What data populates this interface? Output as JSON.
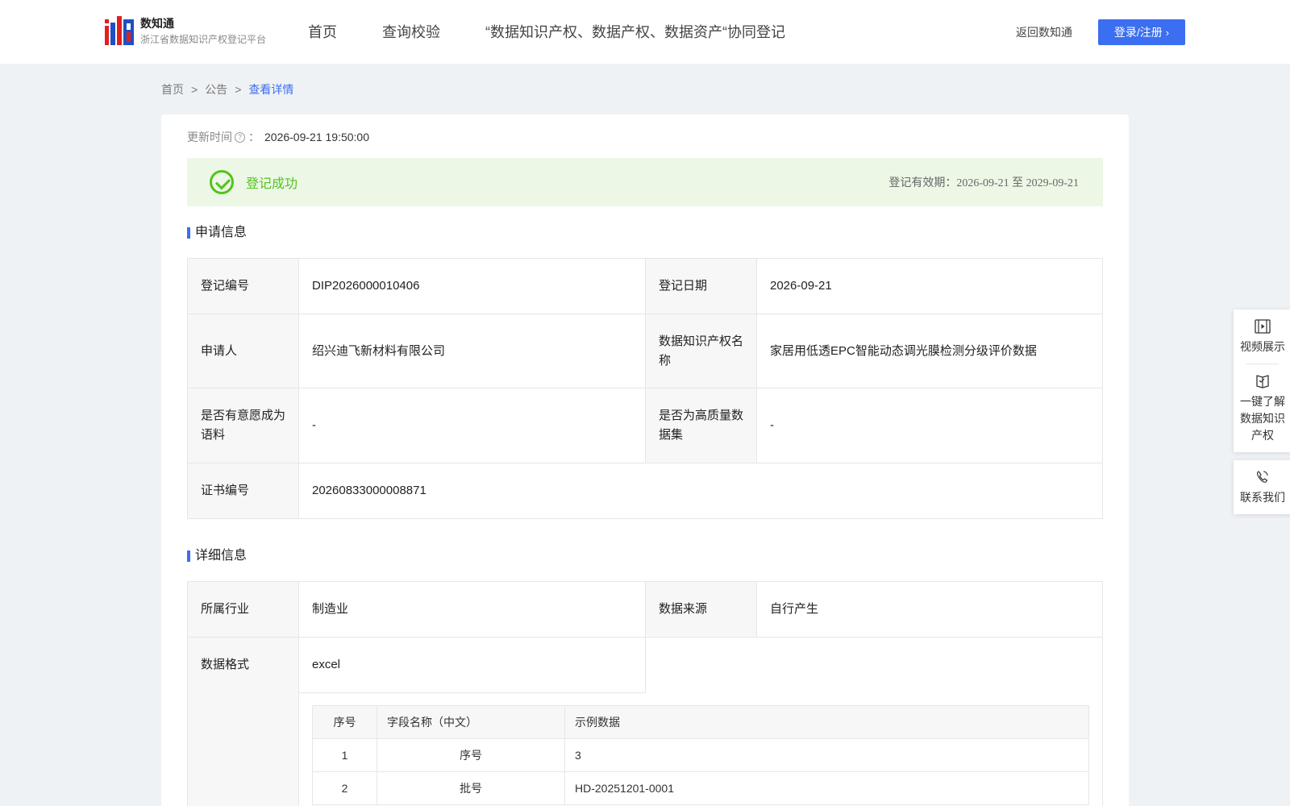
{
  "header": {
    "logo_name": "数知通",
    "logo_sub": "浙江省数据知识产权登记平台",
    "nav": [
      "首页",
      "查询校验",
      "“数据知识产权、数据产权、数据资产“协同登记"
    ],
    "back_link": "返回数知通",
    "login_label": "登录/注册"
  },
  "breadcrumb": {
    "items": [
      "首页",
      "公告",
      "查看详情"
    ],
    "sep": ">"
  },
  "update": {
    "label": "更新时间",
    "colon": "：",
    "value": "2026-09-21 19:50:00"
  },
  "status": {
    "text": "登记成功",
    "validity": "登记有效期：2026-09-21 至 2029-09-21",
    "color": "#52c41a"
  },
  "sections": {
    "apply_title": "申请信息",
    "detail_title": "详细信息"
  },
  "apply_info": {
    "reg_no_label": "登记编号",
    "reg_no": "DIP2026000010406",
    "reg_date_label": "登记日期",
    "reg_date": "2026-09-21",
    "applicant_label": "申请人",
    "applicant": "绍兴迪飞新材料有限公司",
    "ip_name_label": "数据知识产权名称",
    "ip_name": "家居用低透EPC智能动态调光膜检测分级评价数据",
    "corpus_label": "是否有意愿成为语料",
    "corpus": "-",
    "hq_label": "是否为高质量数据集",
    "hq": "-",
    "cert_label": "证书编号",
    "cert": "20260833000008871"
  },
  "detail_info": {
    "industry_label": "所属行业",
    "industry": "制造业",
    "source_label": "数据来源",
    "source": "自行产生",
    "format_label": "数据格式",
    "format": "excel"
  },
  "fields_table": {
    "headers": [
      "序号",
      "字段名称（中文）",
      "示例数据"
    ],
    "rows": [
      [
        "1",
        "序号",
        "3"
      ],
      [
        "2",
        "批号",
        "HD-20251201-0001"
      ]
    ]
  },
  "float_panel": {
    "video": "视频展示",
    "learn": "一键了解数据知识产权",
    "contact": "联系我们"
  },
  "colors": {
    "accent": "#3b6ef0",
    "success": "#52c41a",
    "success_bg": "#ecf7e6"
  }
}
